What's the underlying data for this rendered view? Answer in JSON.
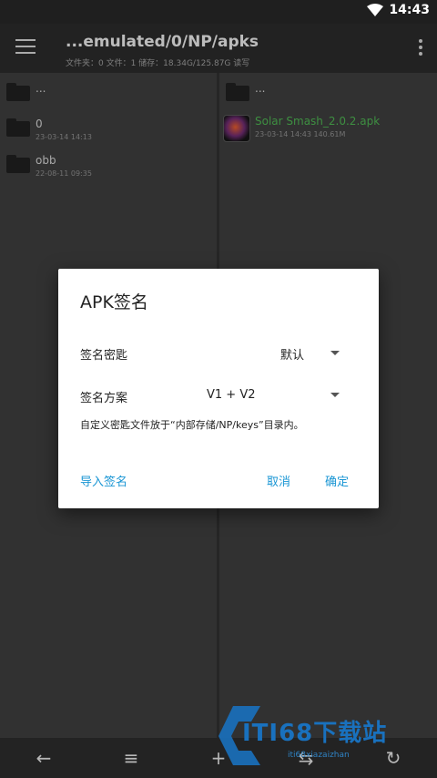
{
  "status_bar": {
    "time": "14:43"
  },
  "toolbar": {
    "title": "...emulated/0/NP/apks",
    "subtitle": "文件夹：0  文件：1  储存：18.34G/125.87G      读写"
  },
  "left_pane": {
    "items": [
      {
        "name": "...",
        "meta": ""
      },
      {
        "name": "0",
        "meta": "23-03-14 14:13"
      },
      {
        "name": "obb",
        "meta": "22-08-11 09:35"
      }
    ]
  },
  "right_pane": {
    "items": [
      {
        "name": "...",
        "meta": ""
      },
      {
        "name": "Solar Smash_2.0.2.apk",
        "meta": "23-03-14 14:43  140.61M"
      }
    ]
  },
  "dialog": {
    "title": "APK签名",
    "key_label": "签名密匙",
    "key_value": "默认",
    "scheme_label": "签名方案",
    "scheme_value": "V1 + V2",
    "note": "自定义密匙文件放于“内部存储/NP/keys”目录内。",
    "import_label": "导入签名",
    "cancel_label": "取消",
    "confirm_label": "确定"
  },
  "bottom_bar": {
    "back_glyph": "←",
    "list_glyph": "≡",
    "add_glyph": "+",
    "swap_glyph": "⇆",
    "refresh_glyph": "↻"
  },
  "watermark": {
    "text": "ITI68下载站",
    "url": "iti68xiazaizhan"
  },
  "colors": {
    "accent": "#1a96d4",
    "apk_name": "#4caf50"
  }
}
